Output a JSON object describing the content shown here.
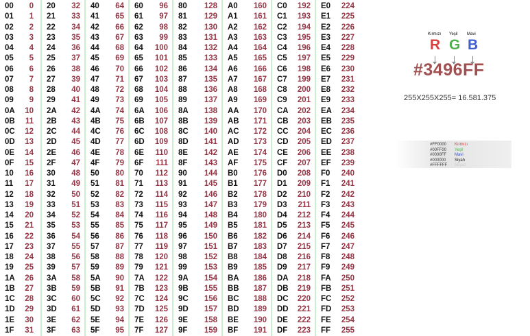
{
  "table": {
    "columns": [
      [
        [
          "00",
          "0"
        ],
        [
          "01",
          "1"
        ],
        [
          "02",
          "2"
        ],
        [
          "03",
          "3"
        ],
        [
          "04",
          "4"
        ],
        [
          "05",
          "5"
        ],
        [
          "06",
          "6"
        ],
        [
          "07",
          "7"
        ],
        [
          "08",
          "8"
        ],
        [
          "09",
          "9"
        ],
        [
          "0A",
          "10"
        ],
        [
          "0B",
          "11"
        ],
        [
          "0C",
          "12"
        ],
        [
          "0D",
          "13"
        ],
        [
          "0E",
          "14"
        ],
        [
          "0F",
          "15"
        ],
        [
          "10",
          "16"
        ],
        [
          "11",
          "17"
        ],
        [
          "12",
          "18"
        ],
        [
          "13",
          "19"
        ],
        [
          "14",
          "20"
        ],
        [
          "15",
          "21"
        ],
        [
          "16",
          "22"
        ],
        [
          "17",
          "23"
        ],
        [
          "18",
          "24"
        ],
        [
          "19",
          "25"
        ],
        [
          "1A",
          "26"
        ],
        [
          "1B",
          "27"
        ],
        [
          "1C",
          "28"
        ],
        [
          "1D",
          "29"
        ],
        [
          "1E",
          "30"
        ],
        [
          "1F",
          "31"
        ]
      ],
      [
        [
          "20",
          "32"
        ],
        [
          "21",
          "33"
        ],
        [
          "22",
          "34"
        ],
        [
          "23",
          "35"
        ],
        [
          "24",
          "36"
        ],
        [
          "25",
          "37"
        ],
        [
          "26",
          "38"
        ],
        [
          "27",
          "39"
        ],
        [
          "28",
          "40"
        ],
        [
          "29",
          "41"
        ],
        [
          "2A",
          "42"
        ],
        [
          "2B",
          "43"
        ],
        [
          "2C",
          "44"
        ],
        [
          "2D",
          "45"
        ],
        [
          "2E",
          "46"
        ],
        [
          "2F",
          "47"
        ],
        [
          "30",
          "48"
        ],
        [
          "31",
          "49"
        ],
        [
          "32",
          "50"
        ],
        [
          "33",
          "51"
        ],
        [
          "34",
          "52"
        ],
        [
          "35",
          "53"
        ],
        [
          "36",
          "54"
        ],
        [
          "37",
          "55"
        ],
        [
          "38",
          "56"
        ],
        [
          "39",
          "57"
        ],
        [
          "3A",
          "58"
        ],
        [
          "3B",
          "59"
        ],
        [
          "3C",
          "60"
        ],
        [
          "3D",
          "61"
        ],
        [
          "3E",
          "62"
        ],
        [
          "3F",
          "63"
        ]
      ],
      [
        [
          "40",
          "64"
        ],
        [
          "41",
          "65"
        ],
        [
          "42",
          "66"
        ],
        [
          "43",
          "67"
        ],
        [
          "44",
          "68"
        ],
        [
          "45",
          "69"
        ],
        [
          "46",
          "70"
        ],
        [
          "47",
          "71"
        ],
        [
          "48",
          "72"
        ],
        [
          "49",
          "73"
        ],
        [
          "4A",
          "74"
        ],
        [
          "4B",
          "75"
        ],
        [
          "4C",
          "76"
        ],
        [
          "4D",
          "77"
        ],
        [
          "4E",
          "78"
        ],
        [
          "4F",
          "79"
        ],
        [
          "50",
          "80"
        ],
        [
          "51",
          "81"
        ],
        [
          "52",
          "82"
        ],
        [
          "53",
          "83"
        ],
        [
          "54",
          "84"
        ],
        [
          "55",
          "85"
        ],
        [
          "56",
          "86"
        ],
        [
          "57",
          "87"
        ],
        [
          "58",
          "88"
        ],
        [
          "59",
          "89"
        ],
        [
          "5A",
          "90"
        ],
        [
          "5B",
          "91"
        ],
        [
          "5C",
          "92"
        ],
        [
          "5D",
          "93"
        ],
        [
          "5E",
          "94"
        ],
        [
          "5F",
          "95"
        ]
      ],
      [
        [
          "60",
          "96"
        ],
        [
          "61",
          "97"
        ],
        [
          "62",
          "98"
        ],
        [
          "63",
          "99"
        ],
        [
          "64",
          "100"
        ],
        [
          "65",
          "101"
        ],
        [
          "66",
          "102"
        ],
        [
          "67",
          "103"
        ],
        [
          "68",
          "104"
        ],
        [
          "69",
          "105"
        ],
        [
          "6A",
          "106"
        ],
        [
          "6B",
          "107"
        ],
        [
          "6C",
          "108"
        ],
        [
          "6D",
          "109"
        ],
        [
          "6E",
          "110"
        ],
        [
          "6F",
          "111"
        ],
        [
          "70",
          "112"
        ],
        [
          "71",
          "113"
        ],
        [
          "72",
          "114"
        ],
        [
          "73",
          "115"
        ],
        [
          "74",
          "116"
        ],
        [
          "75",
          "117"
        ],
        [
          "76",
          "118"
        ],
        [
          "77",
          "119"
        ],
        [
          "78",
          "120"
        ],
        [
          "79",
          "121"
        ],
        [
          "7A",
          "122"
        ],
        [
          "7B",
          "123"
        ],
        [
          "7C",
          "124"
        ],
        [
          "7D",
          "125"
        ],
        [
          "7E",
          "126"
        ],
        [
          "7F",
          "127"
        ]
      ],
      [
        [
          "80",
          "128"
        ],
        [
          "81",
          "129"
        ],
        [
          "82",
          "130"
        ],
        [
          "83",
          "131"
        ],
        [
          "84",
          "132"
        ],
        [
          "85",
          "133"
        ],
        [
          "86",
          "134"
        ],
        [
          "87",
          "135"
        ],
        [
          "88",
          "136"
        ],
        [
          "89",
          "137"
        ],
        [
          "8A",
          "138"
        ],
        [
          "8B",
          "139"
        ],
        [
          "8C",
          "140"
        ],
        [
          "8D",
          "141"
        ],
        [
          "8E",
          "142"
        ],
        [
          "8F",
          "143"
        ],
        [
          "90",
          "144"
        ],
        [
          "91",
          "145"
        ],
        [
          "92",
          "146"
        ],
        [
          "93",
          "147"
        ],
        [
          "94",
          "148"
        ],
        [
          "95",
          "149"
        ],
        [
          "96",
          "150"
        ],
        [
          "97",
          "151"
        ],
        [
          "98",
          "152"
        ],
        [
          "99",
          "153"
        ],
        [
          "9A",
          "154"
        ],
        [
          "9B",
          "155"
        ],
        [
          "9C",
          "156"
        ],
        [
          "9D",
          "157"
        ],
        [
          "9E",
          "158"
        ],
        [
          "9F",
          "159"
        ]
      ],
      [
        [
          "A0",
          "160"
        ],
        [
          "A1",
          "161"
        ],
        [
          "A2",
          "162"
        ],
        [
          "A3",
          "163"
        ],
        [
          "A4",
          "164"
        ],
        [
          "A5",
          "165"
        ],
        [
          "A6",
          "166"
        ],
        [
          "A7",
          "167"
        ],
        [
          "A8",
          "168"
        ],
        [
          "A9",
          "169"
        ],
        [
          "AA",
          "170"
        ],
        [
          "AB",
          "171"
        ],
        [
          "AC",
          "172"
        ],
        [
          "AD",
          "173"
        ],
        [
          "AE",
          "174"
        ],
        [
          "AF",
          "175"
        ],
        [
          "B0",
          "176"
        ],
        [
          "B1",
          "177"
        ],
        [
          "B2",
          "178"
        ],
        [
          "B3",
          "179"
        ],
        [
          "B4",
          "180"
        ],
        [
          "B5",
          "181"
        ],
        [
          "B6",
          "182"
        ],
        [
          "B7",
          "183"
        ],
        [
          "B8",
          "184"
        ],
        [
          "B9",
          "185"
        ],
        [
          "BA",
          "186"
        ],
        [
          "BB",
          "187"
        ],
        [
          "BC",
          "188"
        ],
        [
          "BD",
          "189"
        ],
        [
          "BE",
          "190"
        ],
        [
          "BF",
          "191"
        ]
      ],
      [
        [
          "C0",
          "192"
        ],
        [
          "C1",
          "193"
        ],
        [
          "C2",
          "194"
        ],
        [
          "C3",
          "195"
        ],
        [
          "C4",
          "196"
        ],
        [
          "C5",
          "197"
        ],
        [
          "C6",
          "198"
        ],
        [
          "C7",
          "199"
        ],
        [
          "C8",
          "200"
        ],
        [
          "C9",
          "201"
        ],
        [
          "CA",
          "202"
        ],
        [
          "CB",
          "203"
        ],
        [
          "CC",
          "204"
        ],
        [
          "CD",
          "205"
        ],
        [
          "CE",
          "206"
        ],
        [
          "CF",
          "207"
        ],
        [
          "D0",
          "208"
        ],
        [
          "D1",
          "209"
        ],
        [
          "D2",
          "210"
        ],
        [
          "D3",
          "211"
        ],
        [
          "D4",
          "212"
        ],
        [
          "D5",
          "213"
        ],
        [
          "D6",
          "214"
        ],
        [
          "D7",
          "215"
        ],
        [
          "D8",
          "216"
        ],
        [
          "D9",
          "217"
        ],
        [
          "DA",
          "218"
        ],
        [
          "DB",
          "219"
        ],
        [
          "DC",
          "220"
        ],
        [
          "DD",
          "221"
        ],
        [
          "DE",
          "222"
        ],
        [
          "DF",
          "223"
        ]
      ],
      [
        [
          "E0",
          "224"
        ],
        [
          "E1",
          "225"
        ],
        [
          "E2",
          "226"
        ],
        [
          "E3",
          "227"
        ],
        [
          "E4",
          "228"
        ],
        [
          "E5",
          "229"
        ],
        [
          "E6",
          "230"
        ],
        [
          "E7",
          "231"
        ],
        [
          "E8",
          "232"
        ],
        [
          "E9",
          "233"
        ],
        [
          "EA",
          "234"
        ],
        [
          "EB",
          "235"
        ],
        [
          "EC",
          "236"
        ],
        [
          "ED",
          "237"
        ],
        [
          "EE",
          "238"
        ],
        [
          "EF",
          "239"
        ],
        [
          "F0",
          "240"
        ],
        [
          "F1",
          "241"
        ],
        [
          "F2",
          "242"
        ],
        [
          "F3",
          "243"
        ],
        [
          "F4",
          "244"
        ],
        [
          "F5",
          "245"
        ],
        [
          "F6",
          "246"
        ],
        [
          "F7",
          "247"
        ],
        [
          "F8",
          "248"
        ],
        [
          "F9",
          "249"
        ],
        [
          "FA",
          "250"
        ],
        [
          "FB",
          "251"
        ],
        [
          "FC",
          "252"
        ],
        [
          "FD",
          "253"
        ],
        [
          "FE",
          "254"
        ],
        [
          "FF",
          "255"
        ]
      ]
    ]
  },
  "rgb": {
    "names": {
      "red": "Kırmızı",
      "green": "Yeşil",
      "blue": "Mavi"
    },
    "letters": {
      "red": "R",
      "green": "G",
      "blue": "B"
    },
    "colors": {
      "red": "#d84040",
      "green": "#50b050",
      "blue": "#4060d0",
      "hex_code": "#a05050"
    },
    "hex_code": "#3496FF",
    "formula": "255X255X255= 16.581.375",
    "legend": [
      {
        "code": "#FF0000",
        "name": "Kırmızı",
        "color": "#e03030"
      },
      {
        "code": "#00FF00",
        "name": "Yeşil",
        "color": "#40c040"
      },
      {
        "code": "#0000FF",
        "name": "Mavi",
        "color": "#3050e0"
      },
      {
        "code": "#000000",
        "name": "Siyah",
        "color": "#222222"
      },
      {
        "code": "#FFFFFF",
        "name": "Beyaz",
        "color": "#cccccc"
      }
    ]
  }
}
